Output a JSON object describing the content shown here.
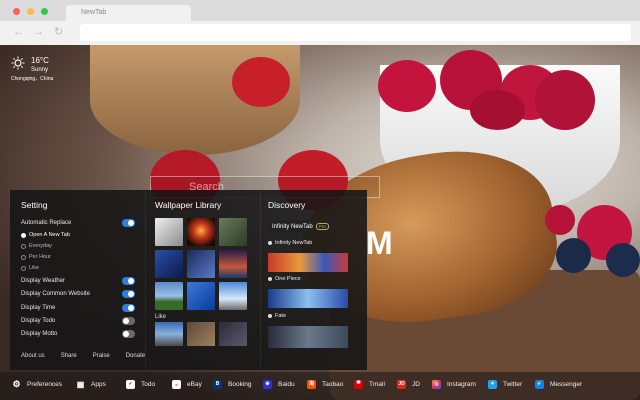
{
  "browser": {
    "tab_title": "NewTab",
    "traffic_colors": [
      "#fc605c",
      "#fdbc40",
      "#34c84a"
    ]
  },
  "weather": {
    "temperature": "16°C",
    "condition": "Sunny",
    "location": "Chongqing，China"
  },
  "search": {
    "placeholder": "Search"
  },
  "logo_letter": "M",
  "panel": {
    "setting": {
      "title": "Setting",
      "automatic_replace": "Automatic Replace",
      "options": [
        "Open A New Tab",
        "Everyday",
        "Per Hour",
        "Like"
      ],
      "display_weather": "Display Weather",
      "display_common_website": "Display Common Website",
      "display_time": "Display Time",
      "display_todo": "Display Todo",
      "display_motto": "Display Motto"
    },
    "footer": [
      "About us",
      "Share",
      "Praise",
      "Donate"
    ],
    "wallpaper": {
      "title": "Wallpaper Library",
      "like_label": "Like"
    },
    "discovery": {
      "title": "Discovery",
      "header": "Infinity NewTab",
      "pro_badge": "Pro",
      "items": [
        "Infinity NewTab",
        "One Piece",
        "Fate"
      ]
    }
  },
  "bottom_bar": {
    "items": [
      "Preferences",
      "Apps",
      "Todo",
      "eBay",
      "Booking",
      "Baidu",
      "Taobao",
      "Tmall",
      "JD",
      "Instagram",
      "Twitter",
      "Messenger"
    ]
  }
}
